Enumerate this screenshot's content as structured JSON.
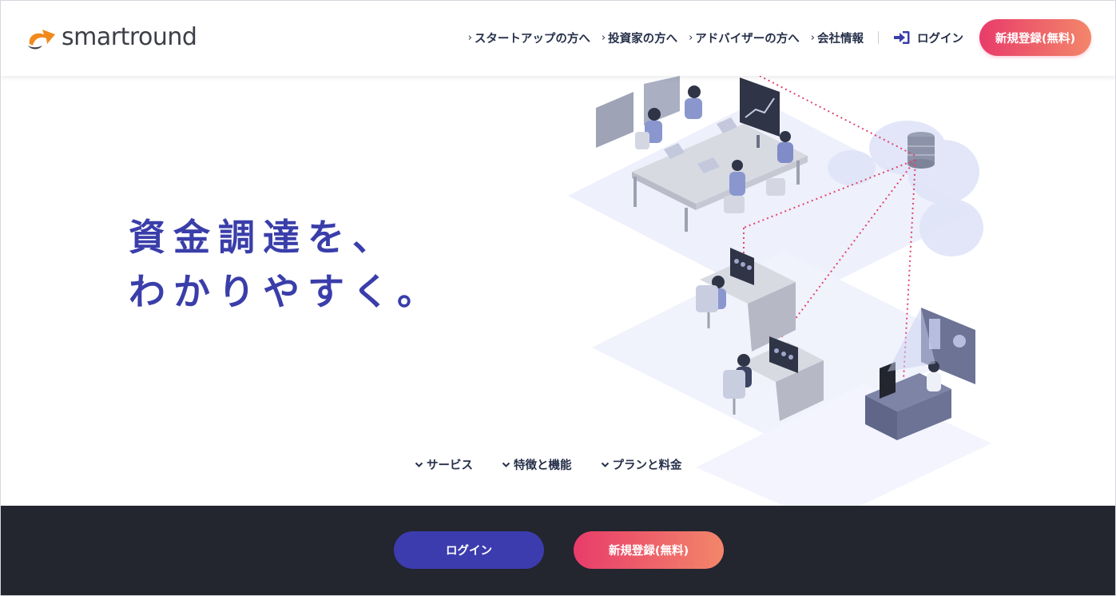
{
  "brand": {
    "name": "smartround",
    "accent_orange": "#f08a1c",
    "accent_blue": "#3a3eaa",
    "signup_gradient": [
      "#e83c6a",
      "#f3866a"
    ]
  },
  "header": {
    "nav": [
      {
        "label": "スタートアップの方へ",
        "icon": "chevron-right-icon"
      },
      {
        "label": "投資家の方へ",
        "icon": "chevron-right-icon"
      },
      {
        "label": "アドバイザーの方へ",
        "icon": "chevron-right-icon"
      },
      {
        "label": "会社情報",
        "icon": "chevron-right-icon"
      }
    ],
    "login_label": "ログイン",
    "login_icon": "sign-in-icon",
    "signup_label": "新規登録(無料)"
  },
  "hero": {
    "headline_line1": "資金調達を、",
    "headline_line2": "わかりやすく。",
    "anchors": [
      {
        "label": "サービス",
        "icon": "chevron-down-icon"
      },
      {
        "label": "特徴と機能",
        "icon": "chevron-down-icon"
      },
      {
        "label": "プランと料金",
        "icon": "chevron-down-icon"
      }
    ]
  },
  "footer_bar": {
    "login_label": "ログイン",
    "signup_label": "新規登録(無料)"
  }
}
